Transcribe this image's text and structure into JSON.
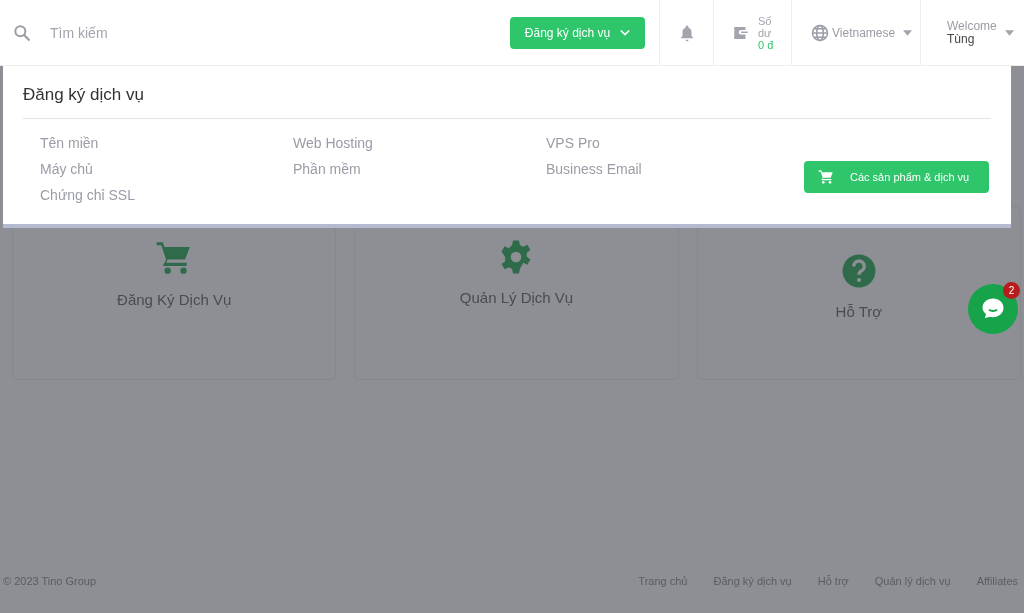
{
  "header": {
    "search": {
      "placeholder": "Tìm kiếm"
    },
    "register_button": "Đăng ký dịch vụ",
    "balance": {
      "label": "Số dư",
      "amount": "0 đ"
    },
    "language": "Vietnamese",
    "user": {
      "greeting": "Welcome",
      "name": "Tùng"
    }
  },
  "dropdown": {
    "title": "Đăng ký dịch vụ",
    "columns": [
      [
        "Tên miền",
        "Máy chủ",
        "Chứng chỉ SSL"
      ],
      [
        "Web Hosting",
        "Phần mềm"
      ],
      [
        "VPS Pro",
        "Business Email"
      ]
    ],
    "all_button": "Các sản phẩm & dịch vụ"
  },
  "cards": [
    {
      "kind": "cart",
      "label": "Đăng Ký Dịch Vụ"
    },
    {
      "kind": "gear",
      "label": "Quản Lý Dịch Vụ"
    },
    {
      "kind": "help",
      "label": "Hỗ Trợ"
    }
  ],
  "chat": {
    "badge": "2"
  },
  "footer": {
    "copyright": "© 2023 Tino Group",
    "links": [
      "Trang chủ",
      "Đăng ký dịch vụ",
      "Hỗ trợ",
      "Quản lý dịch vụ",
      "Affiliates"
    ]
  }
}
